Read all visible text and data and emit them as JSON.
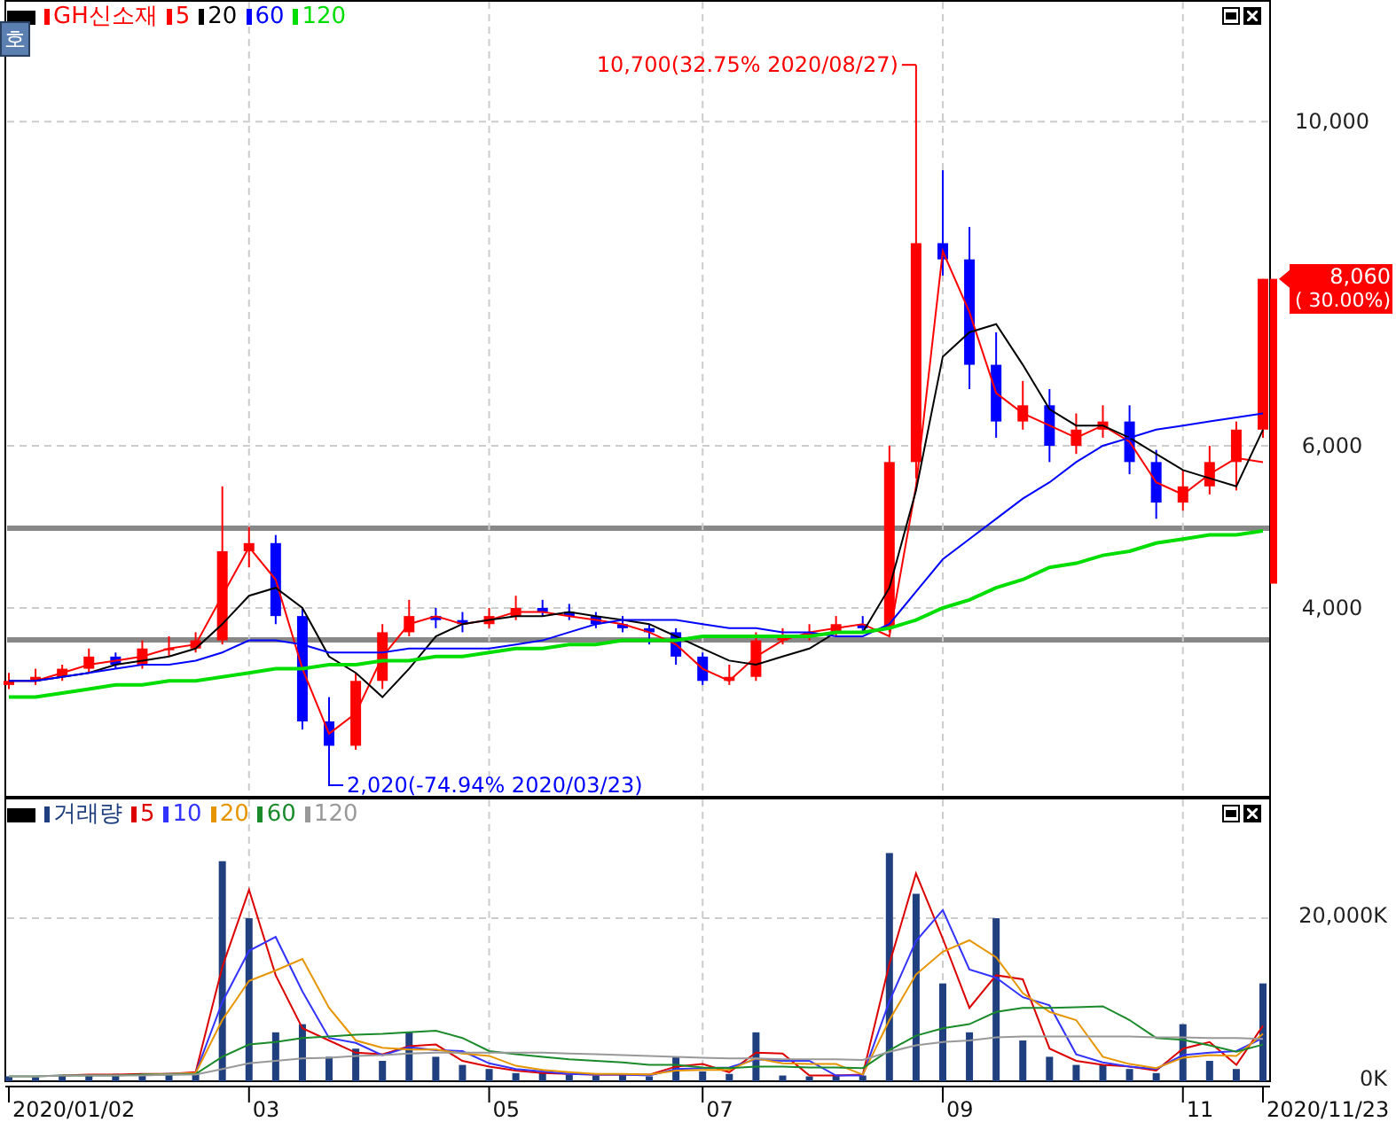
{
  "price_panel": {
    "name": "GH신소재",
    "side_button": "호",
    "price_tag": {
      "price": "8,060",
      "change": "( 30.00%)"
    },
    "chart_data": {
      "type": "candlestick",
      "ylim": [
        1660,
        11500
      ],
      "grid": true,
      "ohlc": [
        [
          3050,
          3200,
          3000,
          3100
        ],
        [
          3100,
          3250,
          3050,
          3150
        ],
        [
          3150,
          3300,
          3100,
          3250
        ],
        [
          3250,
          3500,
          3200,
          3400
        ],
        [
          3400,
          3450,
          3250,
          3300
        ],
        [
          3300,
          3600,
          3250,
          3500
        ],
        [
          3500,
          3650,
          3400,
          3500
        ],
        [
          3500,
          3700,
          3450,
          3600
        ],
        [
          3600,
          5500,
          3550,
          4700
        ],
        [
          4700,
          5000,
          4500,
          4800
        ],
        [
          4800,
          4900,
          3800,
          3900
        ],
        [
          3900,
          4000,
          2500,
          2600
        ],
        [
          2600,
          2900,
          2020,
          2300
        ],
        [
          2300,
          3200,
          2250,
          3100
        ],
        [
          3100,
          3800,
          3000,
          3700
        ],
        [
          3700,
          4100,
          3650,
          3900
        ],
        [
          3900,
          4000,
          3750,
          3850
        ],
        [
          3850,
          3950,
          3700,
          3800
        ],
        [
          3800,
          4000,
          3750,
          3900
        ],
        [
          3900,
          4150,
          3850,
          4000
        ],
        [
          4000,
          4100,
          3900,
          3950
        ],
        [
          3950,
          4050,
          3850,
          3900
        ],
        [
          3900,
          3950,
          3750,
          3800
        ],
        [
          3800,
          3900,
          3700,
          3750
        ],
        [
          3750,
          3800,
          3550,
          3700
        ],
        [
          3700,
          3750,
          3300,
          3400
        ],
        [
          3400,
          3450,
          3050,
          3100
        ],
        [
          3100,
          3300,
          3050,
          3150
        ],
        [
          3150,
          3700,
          3100,
          3600
        ],
        [
          3600,
          3750,
          3550,
          3650
        ],
        [
          3650,
          3800,
          3600,
          3700
        ],
        [
          3700,
          3900,
          3650,
          3800
        ],
        [
          3800,
          3900,
          3700,
          3750
        ],
        [
          3750,
          6000,
          3700,
          5800
        ],
        [
          5800,
          10700,
          5600,
          8500
        ],
        [
          8500,
          9400,
          8100,
          8300
        ],
        [
          8300,
          8700,
          6700,
          7000
        ],
        [
          7000,
          7400,
          6100,
          6300
        ],
        [
          6300,
          6800,
          6200,
          6500
        ],
        [
          6500,
          6700,
          5800,
          6000
        ],
        [
          6000,
          6400,
          5900,
          6200
        ],
        [
          6200,
          6500,
          6100,
          6300
        ],
        [
          6300,
          6500,
          5650,
          5800
        ],
        [
          5800,
          5950,
          5100,
          5300
        ],
        [
          5300,
          5700,
          5200,
          5500
        ],
        [
          5500,
          6000,
          5400,
          5800
        ],
        [
          5800,
          6300,
          5450,
          6200
        ],
        [
          6200,
          8060,
          6100,
          8060
        ]
      ],
      "series": [
        {
          "name": "5",
          "type": "line",
          "color": "#ff0000",
          "values": [
            3100,
            3100,
            3200,
            3300,
            3350,
            3400,
            3500,
            3550,
            4150,
            4750,
            4350,
            3250,
            2450,
            2700,
            3400,
            3800,
            3900,
            3800,
            3850,
            3950,
            3950,
            3900,
            3850,
            3800,
            3700,
            3550,
            3250,
            3100,
            3400,
            3600,
            3700,
            3750,
            3800,
            3650,
            5500,
            8400,
            7650,
            6650,
            6400,
            6250,
            6100,
            6250,
            6050,
            5550,
            5400,
            5650,
            5850,
            5800
          ]
        },
        {
          "name": "20",
          "type": "line",
          "color": "#000000",
          "values": [
            3100,
            3100,
            3150,
            3200,
            3300,
            3350,
            3400,
            3500,
            3800,
            4150,
            4250,
            4000,
            3400,
            3200,
            2900,
            3250,
            3650,
            3800,
            3850,
            3900,
            3900,
            3950,
            3900,
            3850,
            3800,
            3650,
            3500,
            3350,
            3300,
            3400,
            3500,
            3700,
            3700,
            4250,
            5450,
            7100,
            7400,
            7500,
            7000,
            6450,
            6250,
            6250,
            6100,
            5900,
            5700,
            5600,
            5500,
            6200
          ]
        },
        {
          "name": "60",
          "type": "line",
          "color": "#0000ff",
          "values": [
            3100,
            3100,
            3150,
            3200,
            3250,
            3300,
            3300,
            3350,
            3450,
            3600,
            3600,
            3550,
            3450,
            3450,
            3450,
            3500,
            3500,
            3500,
            3500,
            3550,
            3600,
            3700,
            3800,
            3850,
            3850,
            3850,
            3800,
            3750,
            3750,
            3700,
            3700,
            3650,
            3650,
            3800,
            4200,
            4600,
            4850,
            5100,
            5350,
            5550,
            5800,
            6000,
            6100,
            6200,
            6250,
            6300,
            6350,
            6400
          ]
        },
        {
          "name": "120",
          "type": "line",
          "color": "#00dd00",
          "values": [
            2900,
            2900,
            2950,
            3000,
            3050,
            3050,
            3100,
            3100,
            3150,
            3200,
            3250,
            3250,
            3300,
            3300,
            3350,
            3350,
            3400,
            3400,
            3450,
            3500,
            3500,
            3550,
            3550,
            3600,
            3600,
            3600,
            3650,
            3650,
            3650,
            3650,
            3650,
            3700,
            3700,
            3750,
            3850,
            4000,
            4100,
            4250,
            4350,
            4500,
            4550,
            4650,
            4700,
            4800,
            4850,
            4900,
            4900,
            4950
          ]
        }
      ],
      "yticks": [
        {
          "value": 4000,
          "label": "4,000"
        },
        {
          "value": 6000,
          "label": "6,000"
        },
        {
          "value": 10000,
          "label": "10,000"
        }
      ],
      "annotations": [
        "10,700(32.75% 2020/08/27)",
        "2,020(-74.94% 2020/03/23)"
      ]
    }
  },
  "volume_panel": {
    "chart_data": {
      "type": "bar",
      "ylim": [
        0,
        34800
      ],
      "grid": true,
      "series": [
        {
          "name": "거래량",
          "color": "#1f3f7f",
          "values": [
            600,
            500,
            800,
            700,
            900,
            800,
            1000,
            1200,
            27000,
            20000,
            6000,
            7000,
            3000,
            4000,
            2500,
            6000,
            3000,
            2000,
            1500,
            1000,
            1000,
            800,
            700,
            900,
            600,
            3000,
            1200,
            900,
            6000,
            700,
            600,
            800,
            700,
            28000,
            23000,
            12000,
            6000,
            20000,
            5000,
            3000,
            2000,
            2000,
            1500,
            1000,
            7000,
            2500,
            1500,
            12000
          ]
        },
        {
          "name": "5",
          "type": "line",
          "color": "#dd0000",
          "values": [
            null,
            null,
            700,
            800,
            800,
            900,
            900,
            1100,
            14000,
            23500,
            13000,
            6500,
            5000,
            3500,
            3300,
            4300,
            4500,
            2500,
            1800,
            1300,
            1000,
            900,
            800,
            800,
            800,
            1800,
            2100,
            1100,
            3500,
            3400,
            700,
            700,
            800,
            14400,
            25500,
            17500,
            9000,
            13000,
            12500,
            4000,
            2500,
            2000,
            1800,
            1300,
            4000,
            4800,
            2000,
            6800
          ]
        },
        {
          "name": "10",
          "type": "line",
          "color": "#3333ff",
          "values": [
            null,
            null,
            null,
            null,
            null,
            800,
            900,
            1000,
            9700,
            16000,
            17700,
            11000,
            5300,
            4700,
            3200,
            4200,
            3800,
            3700,
            2200,
            1500,
            1200,
            900,
            800,
            800,
            700,
            1500,
            1600,
            1700,
            2700,
            2500,
            2500,
            700,
            700,
            9800,
            17200,
            21000,
            13700,
            12700,
            10300,
            9300,
            3300,
            2300,
            1800,
            1500,
            3200,
            3500,
            3700,
            5300
          ]
        },
        {
          "name": "20",
          "type": "line",
          "color": "#e69500",
          "values": [
            null,
            null,
            null,
            null,
            null,
            800,
            900,
            1000,
            7500,
            12300,
            13600,
            15000,
            9000,
            5000,
            4100,
            3900,
            3900,
            3400,
            3100,
            1900,
            1400,
            1100,
            900,
            900,
            800,
            1300,
            1400,
            1400,
            2800,
            2200,
            2100,
            2100,
            800,
            7500,
            13100,
            15900,
            17300,
            15200,
            10800,
            8500,
            7500,
            3000,
            2100,
            1600,
            2900,
            3200,
            3100,
            5800
          ]
        },
        {
          "name": "60",
          "type": "line",
          "color": "#1a8a2a",
          "values": [
            600,
            600,
            700,
            700,
            700,
            800,
            800,
            900,
            3000,
            4500,
            4800,
            5300,
            5500,
            5700,
            5800,
            6000,
            6200,
            5300,
            3700,
            3300,
            3000,
            2700,
            2500,
            2300,
            2000,
            2000,
            1700,
            1600,
            1800,
            1800,
            1700,
            1700,
            1600,
            3800,
            5600,
            6500,
            7000,
            8500,
            9000,
            9000,
            9100,
            9200,
            7500,
            5300,
            5100,
            4400,
            3600,
            4500
          ]
        },
        {
          "name": "120",
          "type": "line",
          "color": "#999999",
          "values": [
            600,
            600,
            700,
            700,
            700,
            700,
            800,
            800,
            1500,
            2200,
            2500,
            2800,
            2900,
            3100,
            3200,
            3400,
            3500,
            3500,
            3500,
            3500,
            3500,
            3400,
            3300,
            3200,
            3100,
            3000,
            2900,
            2800,
            2800,
            2700,
            2700,
            2700,
            2600,
            3600,
            4400,
            4800,
            5000,
            5400,
            5500,
            5500,
            5500,
            5500,
            5500,
            5400,
            5400,
            5300,
            5300,
            5200
          ]
        }
      ],
      "yticks": [
        {
          "value": 0,
          "label": "0K"
        },
        {
          "value": 20000,
          "label": "20,000K"
        }
      ]
    }
  },
  "date_axis": {
    "labels": [
      "2020/01/02",
      "03",
      "05",
      "07",
      "09",
      "11",
      "2020/11/23"
    ]
  }
}
